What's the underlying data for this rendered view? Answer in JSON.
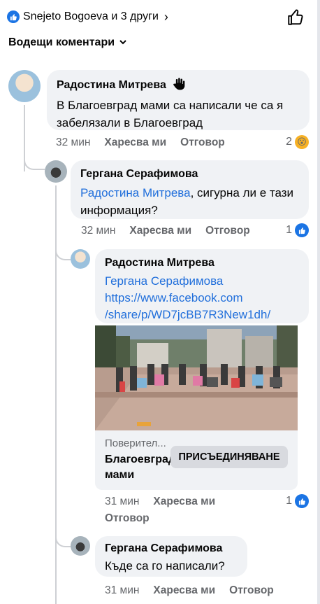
{
  "header": {
    "reactions_text": "Snejeto Bogoeva и 3 други",
    "sort_label": "Водещи коментари"
  },
  "comments": [
    {
      "author": "Радостина Митрева",
      "text": "В Благоевград мами са написали че са я забелязали в Благоевград",
      "time": "32 мин",
      "like_label": "Харесва ми",
      "reply_label": "Отговор",
      "reaction_count": "2",
      "reaction_icon": "wow-icon"
    },
    {
      "author": "Гергана Серафимова",
      "mention": "Радостина Митрева",
      "text": ", сигурна ли е тази информация?",
      "time": "32 мин",
      "like_label": "Харесва ми",
      "reply_label": "Отговор",
      "reaction_count": "1",
      "reaction_icon": "like-icon"
    },
    {
      "author": "Радостина Митрева",
      "mention": "Гергана Серафимова",
      "url_line1": "https://www.facebook.com",
      "url_line2": "/share/p/WD7jcBB7R3New1dh/",
      "preview": {
        "domain": "Поверител...",
        "title": "Благоевградски мами",
        "join_label": "ПРИСЪЕДИНЯВАНЕ"
      },
      "time": "31 мин",
      "like_label": "Харесва ми",
      "reply_label": "Отговор",
      "reaction_count": "1",
      "reaction_icon": "like-icon"
    },
    {
      "author": "Гергана Серафимова",
      "text": "Къде са го написали?",
      "time": "31 мин",
      "like_label": "Харесва ми",
      "reply_label": "Отговор"
    }
  ],
  "colors": {
    "accent": "#1b74e4",
    "link": "#216fdb",
    "bubble": "#f0f2f5",
    "meta": "#65676b"
  }
}
